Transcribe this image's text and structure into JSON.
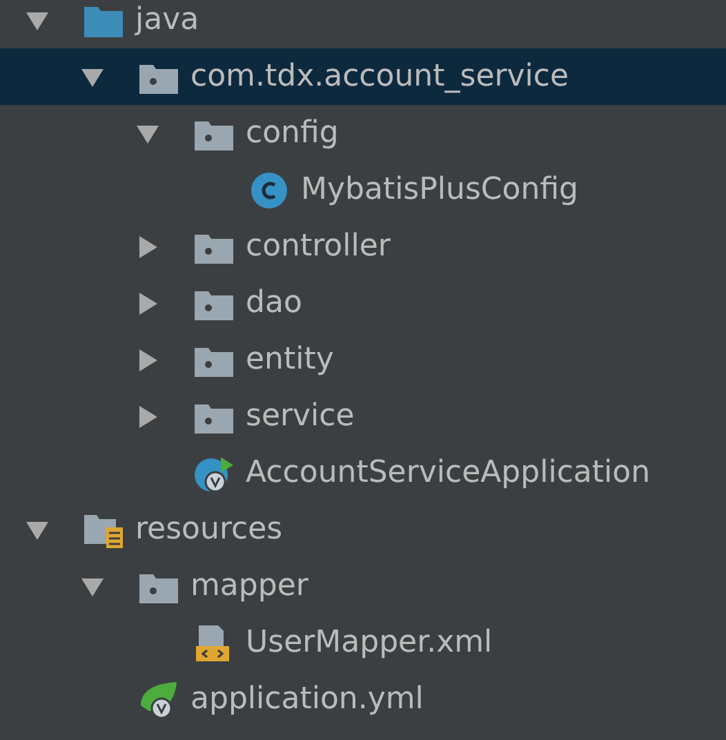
{
  "tree": [
    {
      "label": "java",
      "kind": "source-root",
      "expanded": true,
      "selected": false,
      "children": [
        {
          "label": "com.tdx.account_service",
          "kind": "package",
          "expanded": true,
          "selected": true,
          "children": [
            {
              "label": "config",
              "kind": "package",
              "expanded": true,
              "selected": false,
              "children": [
                {
                  "label": "MybatisPlusConfig",
                  "kind": "class",
                  "selected": false
                }
              ]
            },
            {
              "label": "controller",
              "kind": "package",
              "expanded": false,
              "selected": false
            },
            {
              "label": "dao",
              "kind": "package",
              "expanded": false,
              "selected": false
            },
            {
              "label": "entity",
              "kind": "package",
              "expanded": false,
              "selected": false
            },
            {
              "label": "service",
              "kind": "package",
              "expanded": false,
              "selected": false
            },
            {
              "label": "AccountServiceApplication",
              "kind": "spring-class",
              "selected": false
            }
          ]
        }
      ]
    },
    {
      "label": "resources",
      "kind": "resources-root",
      "expanded": true,
      "selected": false,
      "children": [
        {
          "label": "mapper",
          "kind": "package",
          "expanded": true,
          "selected": false,
          "children": [
            {
              "label": "UserMapper.xml",
              "kind": "xml",
              "selected": false
            }
          ]
        },
        {
          "label": "application.yml",
          "kind": "spring-config",
          "selected": false
        }
      ]
    }
  ]
}
